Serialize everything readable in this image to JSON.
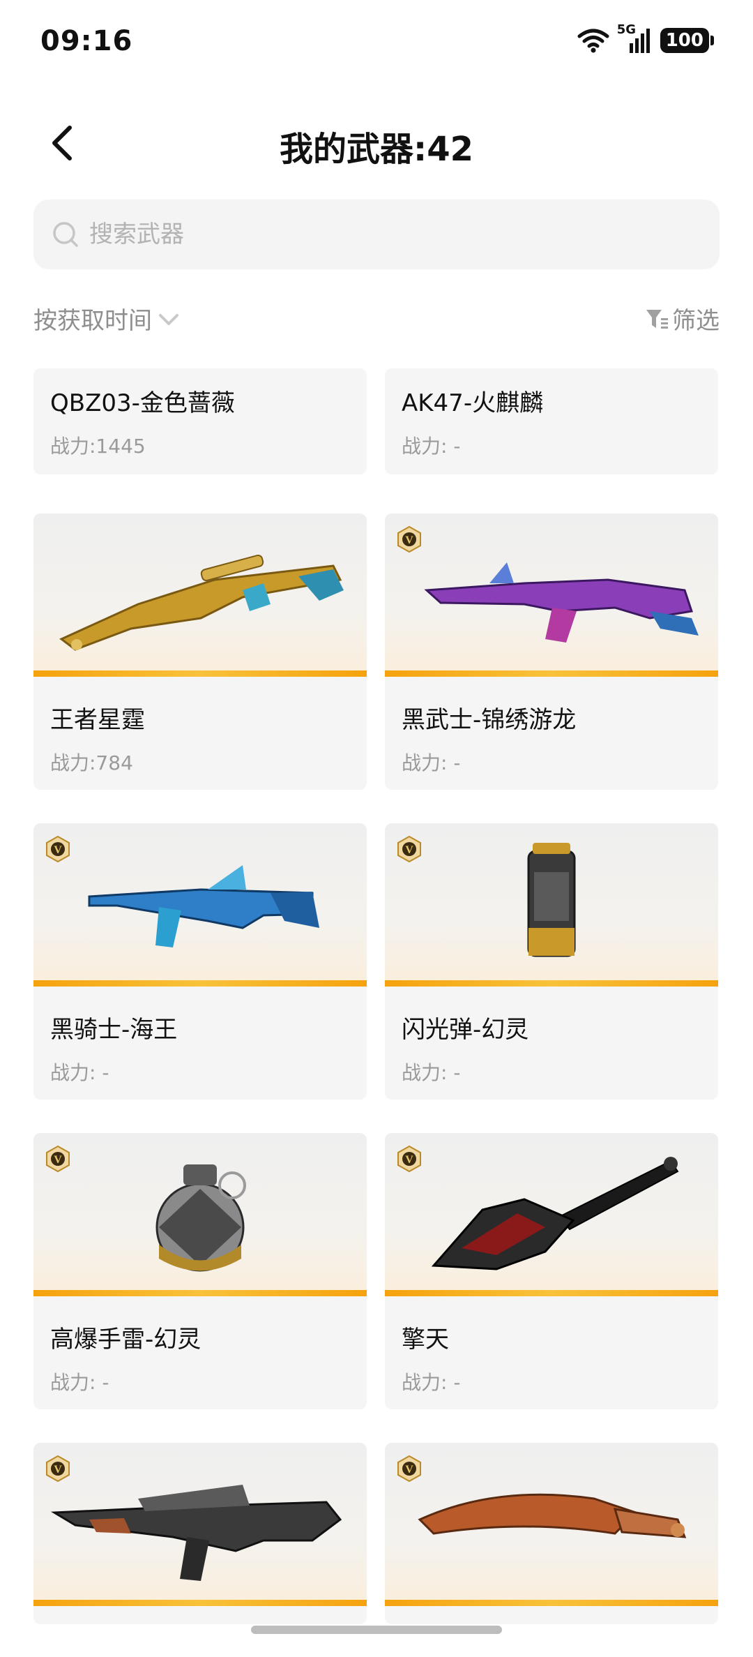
{
  "status_bar": {
    "time": "09:16",
    "network": "5G",
    "battery": "100"
  },
  "header": {
    "title": "我的武器:42"
  },
  "search": {
    "placeholder": "搜索武器"
  },
  "sort": {
    "label": "按获取时间"
  },
  "filter": {
    "label": "筛选"
  },
  "colors": {
    "accent_orange": "#f5a20e",
    "card_bg": "#f5f5f5",
    "muted_text": "#9a9a9a"
  },
  "weapons": [
    {
      "name": "QBZ03-金色蔷薇",
      "power": "战力:1445",
      "icon": "rifle-gold-icon",
      "vip": false
    },
    {
      "name": "AK47-火麒麟",
      "power": "战力: -",
      "icon": "rifle-red-icon",
      "vip": false
    },
    {
      "name": "王者星霆",
      "power": "战力:784",
      "icon": "sniper-rifle-icon",
      "vip": false
    },
    {
      "name": "黑武士-锦绣游龙",
      "power": "战力: -",
      "icon": "ak-rifle-icon",
      "vip": true
    },
    {
      "name": "黑骑士-海王",
      "power": "战力: -",
      "icon": "assault-rifle-icon",
      "vip": true
    },
    {
      "name": "闪光弹-幻灵",
      "power": "战力: -",
      "icon": "flashbang-icon",
      "vip": true
    },
    {
      "name": "高爆手雷-幻灵",
      "power": "战力: -",
      "icon": "grenade-icon",
      "vip": true
    },
    {
      "name": "擎天",
      "power": "战力: -",
      "icon": "shovel-icon",
      "vip": true
    },
    {
      "name": "",
      "power": "",
      "icon": "m4-rifle-icon",
      "vip": true
    },
    {
      "name": "",
      "power": "",
      "icon": "kukri-knife-icon",
      "vip": true
    }
  ]
}
